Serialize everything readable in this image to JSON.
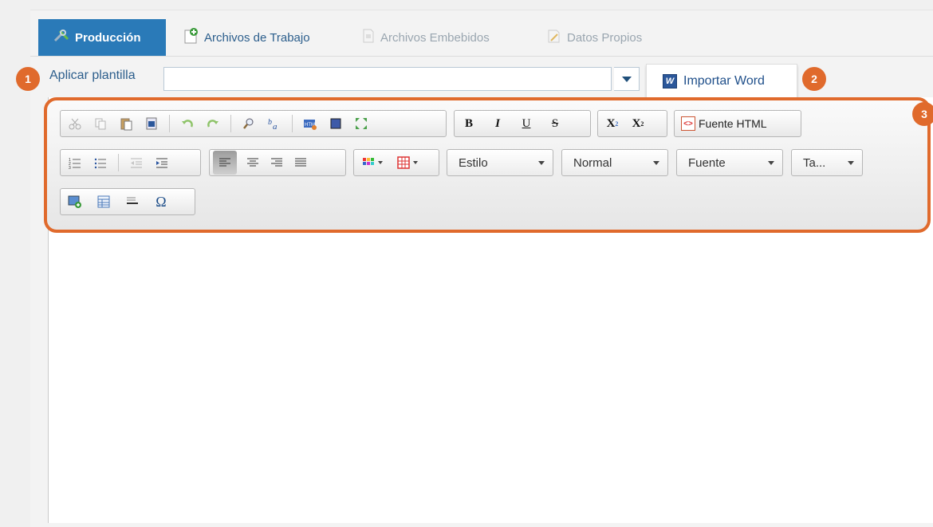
{
  "tabs": [
    {
      "label": "Producción",
      "icon": "wrench-screwdriver-icon",
      "active": true
    },
    {
      "label": "Archivos de Trabajo",
      "icon": "file-add-icon",
      "active": false
    },
    {
      "label": "Archivos Embebidos",
      "icon": "file-lock-icon",
      "active": false
    },
    {
      "label": "Datos Propios",
      "icon": "document-pencil-icon",
      "active": false
    }
  ],
  "template": {
    "label": "Aplicar plantilla",
    "value": ""
  },
  "import_word": {
    "label": "Importar Word",
    "icon_letter": "W"
  },
  "badges": [
    "1",
    "2",
    "3"
  ],
  "toolbar": {
    "format_buttons": [
      "B",
      "I",
      "U",
      "S"
    ],
    "sub_label": "X",
    "sub_mark": "2",
    "sup_label": "X",
    "sup_mark": "2",
    "html_source_label": "Fuente HTML",
    "style_combo": "Estilo",
    "format_combo": "Normal",
    "font_combo": "Fuente",
    "size_combo": "Ta...",
    "special_char": "Ω"
  },
  "colors": {
    "accent_orange": "#e06a2c",
    "tab_active_bg": "#2a7ab8",
    "link_blue": "#2c5e8c"
  }
}
